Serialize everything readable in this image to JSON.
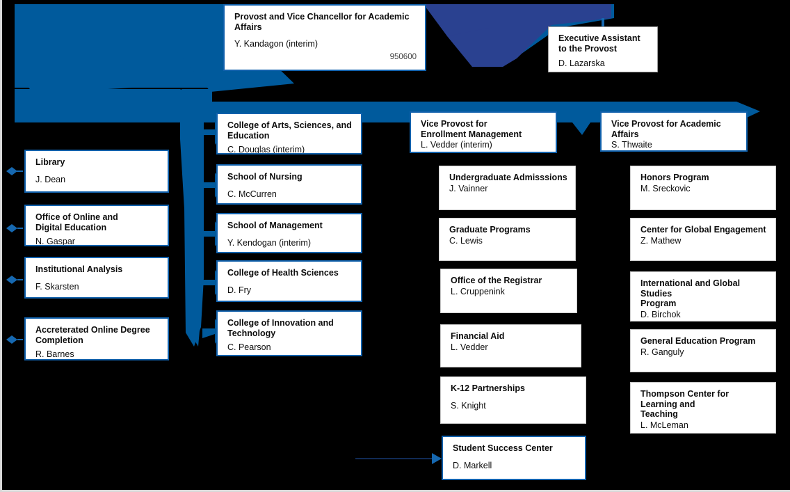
{
  "chart_data": {
    "type": "diagram",
    "diagram_kind": "organizational-chart",
    "title": "Provost and Vice Chancellor for Academic Affairs org chart",
    "colors": {
      "background": "#000000",
      "primary_blue": "#005a9c",
      "secondary_blue": "#2a4190",
      "box_fill": "#ffffff",
      "box_border_highlight": "#1161ac",
      "box_border_plain": "#c9c9c9",
      "connector_blue": "#1668b0",
      "connector_dark": "#102a54",
      "text": "#0d0d0d"
    },
    "nodes": [
      {
        "id": "provost",
        "title": "Provost and Vice Chancellor for Academic Affairs",
        "name": "Y. Kandagon\n(interim)",
        "code": "950600",
        "level": 0
      },
      {
        "id": "exec-assistant",
        "title": "Executive Assistant to the Provost",
        "name": "D. Lazarska",
        "level": 1
      },
      {
        "id": "col-arts",
        "title": "College of Arts, Sciences, and Education",
        "name": "C. Douglas (interim)",
        "level": 1
      },
      {
        "id": "vp-enrollment",
        "title": "Vice Provost for Enrollment Management",
        "name": "L. Vedder (interim)",
        "level": 1
      },
      {
        "id": "vp-academic",
        "title": "Vice Provost for Academic Affairs",
        "name": "S. Thwaite",
        "level": 1
      }
    ],
    "columns": 4
  },
  "top": {
    "provost": {
      "title": "Provost and Vice Chancellor for Academic Affairs",
      "name": "Y. Kandagon\n(interim)",
      "code": "950600"
    },
    "exec_assistant": {
      "title": "Executive Assistant to the Provost",
      "name": "D. Lazarska"
    }
  },
  "column1": {
    "boxes": [
      {
        "title": "Library",
        "name": "J. Dean"
      },
      {
        "title": "Office of Online and\nDigital Education",
        "name": "N. Gaspar"
      },
      {
        "title": "Institutional Analysis",
        "name": "F. Skarsten"
      },
      {
        "title": "Accreterated Online Degree\nCompletion",
        "name": "R. Barnes"
      }
    ]
  },
  "column2": {
    "head": {
      "title": "College of Arts, Sciences, and\nEducation",
      "name": "C. Douglas (interim)"
    },
    "boxes": [
      {
        "title": "School of Nursing",
        "name": "C. McCurren"
      },
      {
        "title": "School of Management",
        "name": "Y. Kendogan (interim)"
      },
      {
        "title": "College of Health Sciences",
        "name": "D. Fry"
      },
      {
        "title": "College of Innovation and\nTechnology",
        "name": "C. Pearson"
      }
    ]
  },
  "column3": {
    "head": {
      "title": "Vice Provost for\nEnrollment Management",
      "name": "L. Vedder (interim)"
    },
    "boxes": [
      {
        "title": "Undergraduate Admisssions",
        "name": "J. Vainner"
      },
      {
        "title": "Graduate Programs",
        "name": "C. Lewis"
      },
      {
        "title": "Office of the Registrar",
        "name": "L. Cruppenink"
      },
      {
        "title": "Financial Aid",
        "name": "L. Vedder"
      },
      {
        "title": "K-12 Partnerships",
        "name": "S. Knight"
      },
      {
        "title": "Student Success Center",
        "name": "D. Markell"
      }
    ]
  },
  "column4": {
    "head": {
      "title": "Vice Provost for Academic Affairs",
      "name": "S. Thwaite"
    },
    "boxes": [
      {
        "title": "Honors Program",
        "name": "M. Sreckovic"
      },
      {
        "title": "Center for Global Engagement",
        "name": "Z. Mathew"
      },
      {
        "title": "International and Global Studies\nProgram",
        "name": "D. Birchok"
      },
      {
        "title": "General Education Program",
        "name": "R. Ganguly"
      },
      {
        "title": "Thompson Center for Learning and\nTeaching",
        "name": "L. McLeman"
      }
    ]
  }
}
